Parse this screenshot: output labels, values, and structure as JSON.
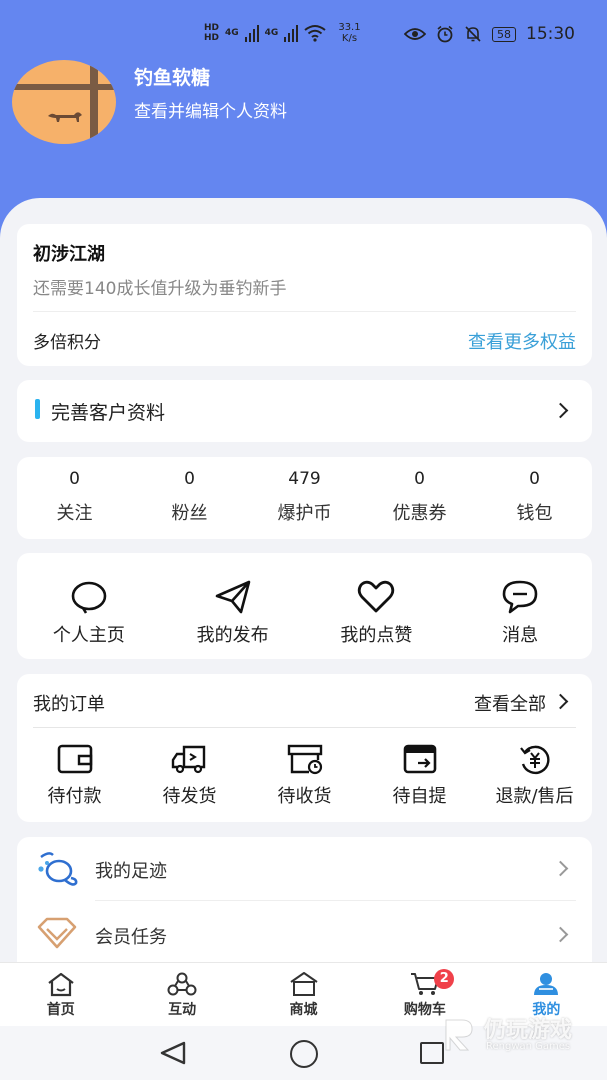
{
  "status_bar": {
    "hd1": "HD",
    "hd2": "HD",
    "net1": "4G",
    "net2": "4G",
    "speed_value": "33.1",
    "speed_unit": "K/s",
    "battery": "58",
    "time": "15:30"
  },
  "profile": {
    "name": "钓鱼软糖",
    "subtitle": "查看并编辑个人资料"
  },
  "level": {
    "title": "初涉江湖",
    "description": "还需要140成长值升级为垂钓新手",
    "points_label": "多倍积分",
    "more_link": "查看更多权益"
  },
  "complete_profile": {
    "label": "完善客户资料"
  },
  "stats": [
    {
      "value": "0",
      "label": "关注"
    },
    {
      "value": "0",
      "label": "粉丝"
    },
    {
      "value": "479",
      "label": "爆护币"
    },
    {
      "value": "0",
      "label": "优惠券"
    },
    {
      "value": "0",
      "label": "钱包"
    }
  ],
  "quick_actions": [
    {
      "label": "个人主页",
      "icon": "chat-bubble-icon"
    },
    {
      "label": "我的发布",
      "icon": "send-icon"
    },
    {
      "label": "我的点赞",
      "icon": "heart-icon"
    },
    {
      "label": "消息",
      "icon": "message-icon"
    }
  ],
  "orders": {
    "title": "我的订单",
    "view_all": "查看全部",
    "items": [
      {
        "label": "待付款",
        "icon": "wallet-icon"
      },
      {
        "label": "待发货",
        "icon": "truck-icon"
      },
      {
        "label": "待收货",
        "icon": "receive-box-icon"
      },
      {
        "label": "待自提",
        "icon": "pickup-card-icon"
      },
      {
        "label": "退款/售后",
        "icon": "refund-icon"
      }
    ]
  },
  "list_rows": [
    {
      "label": "我的足迹",
      "icon": "footprint-icon"
    },
    {
      "label": "会员任务",
      "icon": "diamond-icon"
    }
  ],
  "tabbar": {
    "cart_badge": "2",
    "tabs": [
      {
        "label": "首页",
        "icon": "home-icon"
      },
      {
        "label": "互动",
        "icon": "interaction-icon"
      },
      {
        "label": "商城",
        "icon": "store-icon"
      },
      {
        "label": "购物车",
        "icon": "cart-icon"
      },
      {
        "label": "我的",
        "icon": "user-icon"
      }
    ]
  },
  "watermark": {
    "text": "仍玩游戏",
    "sub": "Rengwan Games"
  },
  "colors": {
    "header": "#6486f0",
    "accent_link": "#3aa0d8",
    "active_tab": "#2f8fe0",
    "badge": "#f0414a"
  }
}
